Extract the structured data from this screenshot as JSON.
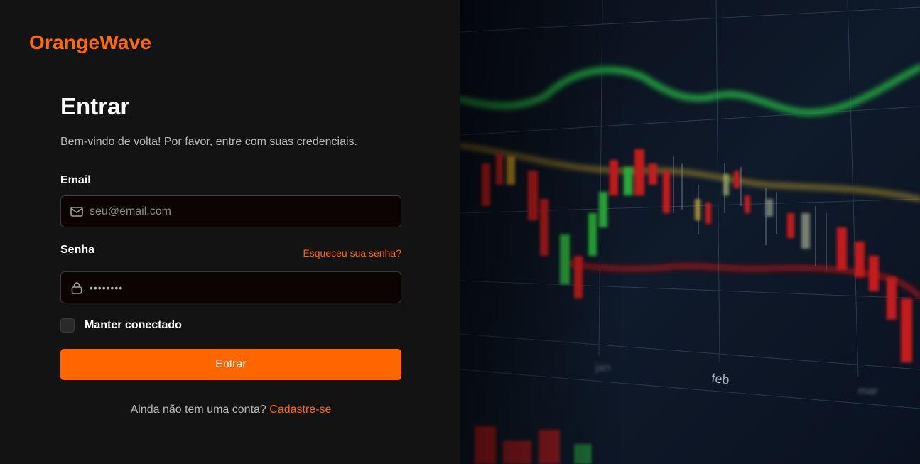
{
  "brand": "OrangeWave",
  "login": {
    "title": "Entrar",
    "subtitle": "Bem-vindo de volta! Por favor, entre com suas credenciais.",
    "email_label": "Email",
    "email_placeholder": "seu@email.com",
    "password_label": "Senha",
    "password_value": "••••••••",
    "forgot_label": "Esqueceu sua senha?",
    "remember_label": "Manter conectado",
    "submit_label": "Entrar",
    "signup_prompt": "Ainda não tem uma conta?",
    "signup_link": "Cadastre-se"
  },
  "hero": {
    "axis_label": "feb",
    "image": "stock-market-candlestick-chart-photo"
  },
  "colors": {
    "accent": "#ff6600",
    "background": "#131313",
    "input_background": "#0c0303"
  }
}
